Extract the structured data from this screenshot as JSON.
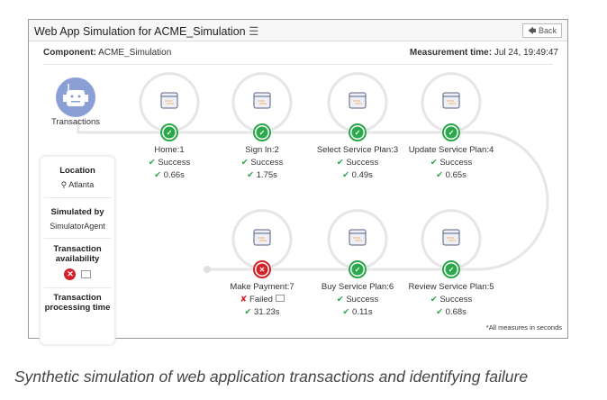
{
  "header": {
    "title": "Web App Simulation for ACME_Simulation",
    "back_label": "Back"
  },
  "component": {
    "label": "Component:",
    "value": "ACME_Simulation"
  },
  "measurement": {
    "label": "Measurement time:",
    "value": "Jul 24, 19:49:47"
  },
  "start_label": "Transactions",
  "steps": [
    {
      "name": "Home:1",
      "status": "Success",
      "time": "0.66s"
    },
    {
      "name": "Sign In:2",
      "status": "Success",
      "time": "1.75s"
    },
    {
      "name": "Select Service Plan:3",
      "status": "Success",
      "time": "0.49s"
    },
    {
      "name": "Update Service Plan:4",
      "status": "Success",
      "time": "0.65s"
    },
    {
      "name": "Review Service Plan:5",
      "status": "Success",
      "time": "0.68s"
    },
    {
      "name": "Buy Service Plan:6",
      "status": "Success",
      "time": "0.11s"
    },
    {
      "name": "Make Payment:7",
      "status": "Failed",
      "time": "31.23s"
    }
  ],
  "side": {
    "location_label": "Location",
    "location": "Atlanta",
    "simulated_label": "Simulated by",
    "simulated": "SimulatorAgent",
    "availability_label": "Transaction availability",
    "processing_label": "Transaction processing time"
  },
  "note": "*All measures in seconds",
  "caption": "Synthetic simulation of web application transactions and identifying failure",
  "colors": {
    "success": "#2ba84a",
    "failed": "#d42027",
    "robot": "#8a9fd6"
  }
}
